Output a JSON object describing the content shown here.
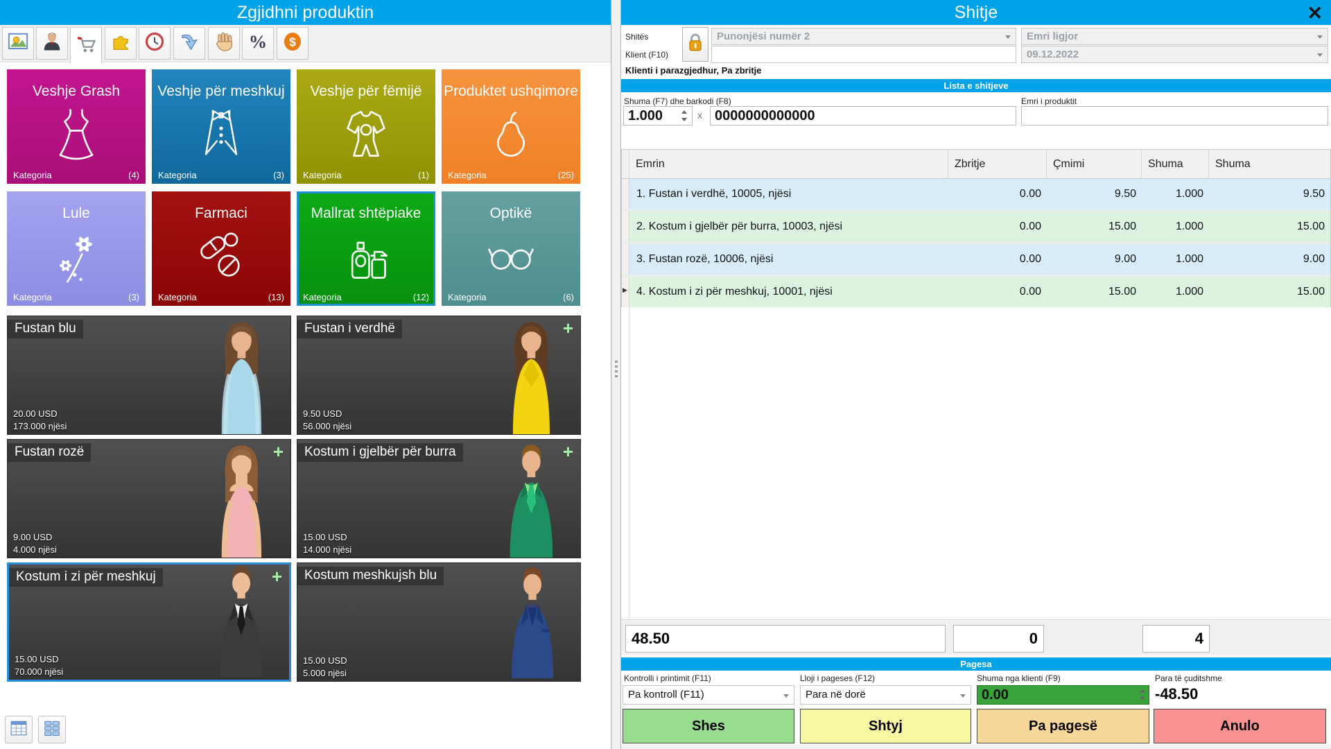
{
  "left_window": {
    "title": "Zgjidhni produktin",
    "toolbar_icons": [
      "picture",
      "person",
      "cart",
      "puzzle",
      "clock",
      "arrow",
      "hand",
      "percent",
      "dollar"
    ],
    "categories": [
      {
        "name": "Veshje Grash",
        "label": "Kategoria",
        "count": "(4)",
        "color": "#b5128a",
        "icon": "dress-icon"
      },
      {
        "name": "Veshje për meshkuj",
        "label": "Kategoria",
        "count": "(3)",
        "color": "#1a78ad",
        "icon": "tuxedo-icon"
      },
      {
        "name": "Veshje për fëmijë",
        "label": "Kategoria",
        "count": "(1)",
        "color": "#9d9e0d",
        "icon": "onesie-icon"
      },
      {
        "name": "Produktet ushqimore",
        "label": "Kategoria",
        "count": "(25)",
        "color": "#f38a33",
        "icon": "pear-icon"
      },
      {
        "name": "Lule",
        "label": "Kategoria",
        "count": "(3)",
        "color": "#9898ea",
        "icon": "flowers-icon"
      },
      {
        "name": "Farmaci",
        "label": "Kategoria",
        "count": "(13)",
        "color": "#970b0b",
        "icon": "pills-icon"
      },
      {
        "name": "Mallrat shtëpiake",
        "label": "Kategoria",
        "count": "(12)",
        "color": "#0a9d12",
        "icon": "bottles-icon",
        "selected": true
      },
      {
        "name": "Optikë",
        "label": "Kategoria",
        "count": "(6)",
        "color": "#5b9898",
        "icon": "glasses-icon"
      }
    ],
    "products": [
      {
        "name": "Fustan blu",
        "price": "20.00 USD",
        "stock": "173.000 njësi",
        "image": "woman-light-blue-dress"
      },
      {
        "name": "Fustan i verdhë",
        "price": "9.50 USD",
        "stock": "56.000 njësi",
        "plus": "+",
        "image": "woman-yellow-dress"
      },
      {
        "name": "Fustan rozë",
        "price": "9.00 USD",
        "stock": "4.000 njësi",
        "plus": "+",
        "image": "woman-pink-dress"
      },
      {
        "name": "Kostum i gjelbër për burra",
        "price": "15.00 USD",
        "stock": "14.000 njësi",
        "plus": "+",
        "image": "man-green-suit"
      },
      {
        "name": "Kostum i zi për meshkuj",
        "price": "15.00 USD",
        "stock": "70.000 njësi",
        "plus": "+",
        "selected": true,
        "image": "man-black-suit"
      },
      {
        "name": "Kostum meshkujsh blu",
        "price": "15.00 USD",
        "stock": "5.000 njësi",
        "image": "man-blue-suit"
      }
    ]
  },
  "right_window": {
    "title": "Shitje",
    "close_label": "✕",
    "seller_label": "Shitës",
    "seller_value": "Punonjësi numër 2",
    "legal_name_value": "Emri ligjor",
    "client_label": "Klient (F10)",
    "client_value": "",
    "date_value": "09.12.2022",
    "client_note": "Klienti i parazgjedhur, Pa zbritje",
    "list_header": "Lista e shitjeve",
    "qty_barcode_label": "Shuma (F7) dhe barkodi (F8)",
    "qty_value": "1.000",
    "times_sign": "x",
    "barcode_value": "0000000000000",
    "product_name_label": "Emri i produktit",
    "product_name_value": "",
    "table": {
      "columns": [
        "Emrin",
        "Zbritje",
        "Çmimi",
        "Shuma",
        "Shuma"
      ],
      "current_row_marker": "▶",
      "rows": [
        {
          "name": "1. Fustan i verdhë, 10005, njësi",
          "discount": "0.00",
          "price": "9.50",
          "qty": "1.000",
          "total": "9.50"
        },
        {
          "name": "2. Kostum i gjelbër për burra, 10003, njësi",
          "discount": "0.00",
          "price": "15.00",
          "qty": "1.000",
          "total": "15.00"
        },
        {
          "name": "3. Fustan rozë, 10006, njësi",
          "discount": "0.00",
          "price": "9.00",
          "qty": "1.000",
          "total": "9.00"
        },
        {
          "name": "4. Kostum i zi për meshkuj, 10001, njësi",
          "discount": "0.00",
          "price": "15.00",
          "qty": "1.000",
          "total": "15.00"
        }
      ]
    },
    "totals": {
      "sum": "48.50",
      "discount": "0",
      "quantity": "4"
    },
    "payment_header": "Pagesa",
    "print_control_label": "Kontrolli i printimit (F11)",
    "print_control_value": "Pa kontroll (F11)",
    "payment_type_label": "Lloji i pageses (F12)",
    "payment_type_value": "Para në dorë",
    "customer_amount_label": "Shuma nga klienti (F9)",
    "customer_amount_value": "0.00",
    "change_label": "Para të çuditshme",
    "change_value": "-48.50",
    "buttons": {
      "sell": "Shes",
      "postpone": "Shtyj",
      "no_payment": "Pa pagesë",
      "cancel": "Anulo"
    }
  },
  "colors": {
    "titlebar_blue": "#00a2e8",
    "row_blue": "#d9ecf9",
    "row_green": "#ddf3df",
    "selection_border": "#1e8fd5",
    "sell_button": "#98dc90",
    "postpone_button": "#f8f8a2",
    "no_payment_button": "#f8d89a",
    "cancel_button": "#f89392",
    "customer_amount_bg": "#3aa23a"
  }
}
